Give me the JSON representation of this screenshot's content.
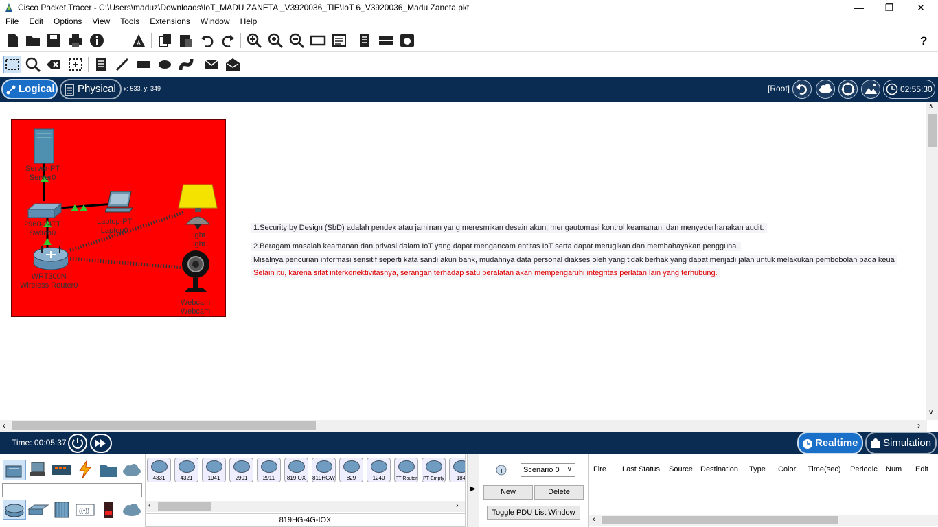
{
  "window": {
    "title": "Cisco Packet Tracer - C:\\Users\\maduz\\Downloads\\IoT_MADU ZANETA _V3920036_TIE\\IoT 6_V3920036_Madu Zaneta.pkt",
    "minimize": "—",
    "restore": "❐",
    "close": "✕"
  },
  "menu": [
    "File",
    "Edit",
    "Options",
    "View",
    "Tools",
    "Extensions",
    "Window",
    "Help"
  ],
  "toolbar": {
    "help": "?",
    "icons": [
      "new-file-icon",
      "open-folder-icon",
      "save-icon",
      "print-icon",
      "info-icon",
      "activity-wizard-icon",
      "copy-icon",
      "paste-icon",
      "undo-icon",
      "redo-icon",
      "zoom-in-icon",
      "zoom-reset-icon",
      "zoom-out-icon",
      "drawing-palette-icon",
      "custom-device-icon",
      "viewport-icon",
      "ip-list-icon",
      "web-view-icon"
    ]
  },
  "toolbar2": {
    "icons": [
      "select-icon",
      "inspect-icon",
      "delete-icon",
      "resize-icon",
      "note-icon",
      "line-icon",
      "rectangle-icon",
      "ellipse-icon",
      "freeform-icon",
      "add-pdu-icon",
      "complex-pdu-icon"
    ]
  },
  "nav": {
    "logical": "Logical",
    "physical": "Physical",
    "coords": "x: 533, y: 349",
    "root": "[Root]",
    "clock": "02:55:30"
  },
  "topology": {
    "devices": [
      {
        "model": "Server-PT",
        "name": "Server0"
      },
      {
        "model": "2960-24TT",
        "name": "Switch0"
      },
      {
        "model": "Laptop-PT",
        "name": "Laptop0"
      },
      {
        "model": "WRT300N",
        "name": "Wireless Router0"
      },
      {
        "model": "Light",
        "name": "Light"
      },
      {
        "model": "Webcam",
        "name": "Webcam"
      }
    ],
    "colors": {
      "area": "#ff0000",
      "lamp": "#f4e200",
      "link_up": "#3c3",
      "wireless": "#333"
    }
  },
  "notes": [
    {
      "text": "1.Security by Design (SbD) adalah pendek atau jaminan yang meresmikan desain akun, mengautomasi kontrol keamanan, dan menyederhanakan audit.",
      "color": "#222"
    },
    {
      "text": "2.Beragam masalah keamanan dan privasi dalam IoT yang dapat mengancam entitas IoT serta dapat merugikan dan membahayakan pengguna.",
      "color": "#222"
    },
    {
      "text": "Misalnya pencurian informasi sensitif seperti kata sandi akun bank, mudahnya data personal diakses oleh yang tidak berhak yang dapat menjadi jalan untuk melakukan pembobolan pada keua",
      "color": "#222"
    },
    {
      "text": "Selain itu, karena sifat interkonektivitasnya, serangan terhadap satu peralatan akan mempengaruhi integritas perlatan lain yang terhubung.",
      "color": "#e00000"
    }
  ],
  "simbar": {
    "time": "Time: 00:05:37",
    "realtime": "Realtime",
    "simulation": "Simulation"
  },
  "device_panel": {
    "models": [
      "4331",
      "4321",
      "1941",
      "2901",
      "2911",
      "819IOX",
      "819HGW",
      "829",
      "1240",
      "PT-Router",
      "PT-Empty",
      "184"
    ],
    "selected_model": "819HG-4G-IOX",
    "categories_top": [
      "network-devices-icon",
      "end-devices-icon",
      "components-icon",
      "connections-icon",
      "misc-icon",
      "multiuser-icon"
    ],
    "categories_bottom": [
      "routers-icon",
      "switches-icon",
      "hubs-icon",
      "wireless-icon",
      "security-icon",
      "wan-emulation-icon"
    ]
  },
  "scenario": {
    "selected": "Scenario 0",
    "new": "New",
    "delete": "Delete",
    "toggle": "Toggle PDU List Window"
  },
  "pdu_table": {
    "columns": [
      "Fire",
      "Last Status",
      "Source",
      "Destination",
      "Type",
      "Color",
      "Time(sec)",
      "Periodic",
      "Num",
      "Edit"
    ]
  }
}
